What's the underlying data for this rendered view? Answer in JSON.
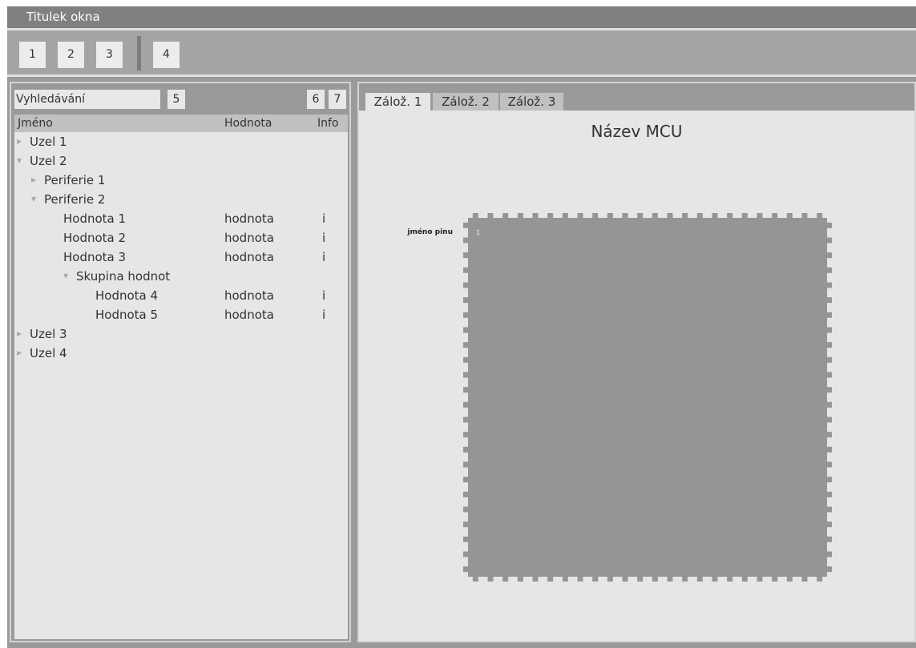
{
  "window": {
    "title": "Titulek okna"
  },
  "toolbar": {
    "buttons": [
      "1",
      "2",
      "3",
      "4"
    ]
  },
  "left_panel": {
    "search_value": "Vyhledávání",
    "search_button": "5",
    "button_6": "6",
    "button_7": "7",
    "columns": {
      "name": "Jméno",
      "value": "Hodnota",
      "info": "Info"
    },
    "rows": [
      {
        "label": "Uzel 1",
        "value": "",
        "info": "",
        "expanded": false,
        "has_children": true
      },
      {
        "label": "Uzel 2",
        "value": "",
        "info": "",
        "expanded": true,
        "has_children": true
      },
      {
        "label": "Periferie 1",
        "value": "",
        "info": "",
        "expanded": false,
        "has_children": true
      },
      {
        "label": "Periferie 2",
        "value": "",
        "info": "",
        "expanded": true,
        "has_children": true
      },
      {
        "label": "Hodnota 1",
        "value": "hodnota",
        "info": "i",
        "has_children": false
      },
      {
        "label": "Hodnota 2",
        "value": "hodnota",
        "info": "i",
        "has_children": false
      },
      {
        "label": "Hodnota 3",
        "value": "hodnota",
        "info": "i",
        "has_children": false
      },
      {
        "label": "Skupina hodnot",
        "value": "",
        "info": "",
        "expanded": true,
        "has_children": true
      },
      {
        "label": "Hodnota 4",
        "value": "hodnota",
        "info": "i",
        "has_children": false
      },
      {
        "label": "Hodnota 5",
        "value": "hodnota",
        "info": "i",
        "has_children": false
      },
      {
        "label": "Uzel 3",
        "value": "",
        "info": "",
        "expanded": false,
        "has_children": true
      },
      {
        "label": "Uzel 4",
        "value": "",
        "info": "",
        "expanded": false,
        "has_children": true
      }
    ]
  },
  "right_panel": {
    "tabs": [
      {
        "label": "Zálož. 1",
        "active": true
      },
      {
        "label": "Zálož. 2",
        "active": false
      },
      {
        "label": "Zálož. 3",
        "active": false
      }
    ],
    "mcu_title": "Název MCU",
    "pin_label": "jméno pinu",
    "pin_number": "1",
    "pins_per_side": 24
  },
  "colors": {
    "title_bar": "#808080",
    "toolbar": "#a4a4a4",
    "panel_bg": "#e6e6e6",
    "header_bg": "#c0c0c0",
    "chip": "#959595"
  }
}
